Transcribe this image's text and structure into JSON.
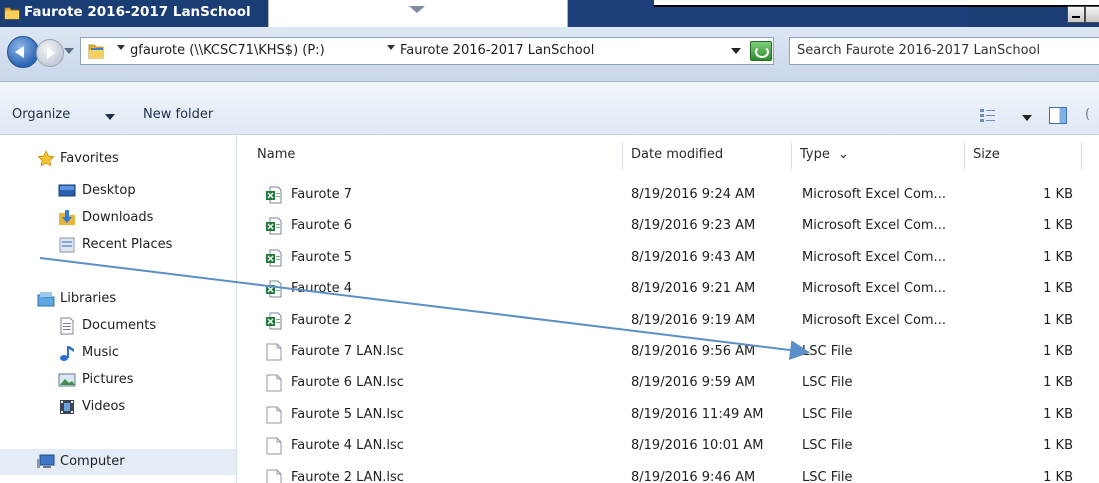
{
  "window": {
    "title": "Faurote 2016-2017 LanSchool"
  },
  "address": {
    "crumbs": [
      "gfaurote (\\\\KCSC71\\KHS$) (P:)",
      "Faurote 2016-2017 LanSchool"
    ],
    "search_placeholder": "Search Faurote 2016-2017 LanSchool"
  },
  "commands": {
    "organize": "Organize",
    "new_folder": "New folder",
    "extra": "("
  },
  "nav": {
    "favorites": "Favorites",
    "desktop": "Desktop",
    "downloads": "Downloads",
    "recent_places": "Recent Places",
    "libraries": "Libraries",
    "documents": "Documents",
    "music": "Music",
    "pictures": "Pictures",
    "videos": "Videos",
    "computer": "Computer"
  },
  "columns": {
    "name": "Name",
    "date_modified": "Date modified",
    "type": "Type",
    "type_sort": "⌄",
    "size": "Size"
  },
  "files": [
    {
      "name": "Faurote 7",
      "date": "8/19/2016 9:24 AM",
      "type": "Microsoft Excel Com...",
      "size": "1 KB",
      "kind": "excel"
    },
    {
      "name": "Faurote 6",
      "date": "8/19/2016 9:23 AM",
      "type": "Microsoft Excel Com...",
      "size": "1 KB",
      "kind": "excel"
    },
    {
      "name": "Faurote 5",
      "date": "8/19/2016 9:43 AM",
      "type": "Microsoft Excel Com...",
      "size": "1 KB",
      "kind": "excel"
    },
    {
      "name": "Faurote 4",
      "date": "8/19/2016 9:21 AM",
      "type": "Microsoft Excel Com...",
      "size": "1 KB",
      "kind": "excel"
    },
    {
      "name": "Faurote 2",
      "date": "8/19/2016 9:19 AM",
      "type": "Microsoft Excel Com...",
      "size": "1 KB",
      "kind": "excel"
    },
    {
      "name": "Faurote 7 LAN.lsc",
      "date": "8/19/2016 9:56 AM",
      "type": "LSC File",
      "size": "1 KB",
      "kind": "lsc"
    },
    {
      "name": "Faurote 6 LAN.lsc",
      "date": "8/19/2016 9:59 AM",
      "type": "LSC File",
      "size": "1 KB",
      "kind": "lsc"
    },
    {
      "name": "Faurote 5 LAN.lsc",
      "date": "8/19/2016 11:49 AM",
      "type": "LSC File",
      "size": "1 KB",
      "kind": "lsc"
    },
    {
      "name": "Faurote 4 LAN.lsc",
      "date": "8/19/2016 10:01 AM",
      "type": "LSC File",
      "size": "1 KB",
      "kind": "lsc"
    },
    {
      "name": "Faurote 2 LAN.lsc",
      "date": "8/19/2016 9:46 AM",
      "type": "LSC File",
      "size": "1 KB",
      "kind": "lsc"
    }
  ],
  "colors": {
    "titlebar": "#1a3d74",
    "annotation_arrow": "#5b8fc7",
    "excel_green": "#1f7a3c"
  }
}
